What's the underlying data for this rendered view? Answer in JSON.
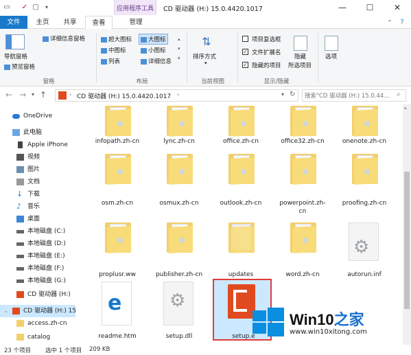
{
  "titlebar": {
    "context_tab": "应用程序工具",
    "title": "CD 驱动器 (H:) 15.0.4420.1017",
    "minimize": "—",
    "maximize": "☐",
    "close": "✕"
  },
  "tabs": {
    "file": "文件",
    "home": "主页",
    "share": "共享",
    "view": "查看",
    "manage": "管理"
  },
  "ribbon": {
    "nav_pane": "导航窗格",
    "preview_pane": "预览窗格",
    "details_pane": "详细信息窗格",
    "group_panes": "窗格",
    "layout": {
      "xl_icons": "超大图标",
      "large_icons": "大图标",
      "medium_icons": "中图标",
      "small_icons": "小图标",
      "list": "列表",
      "details": "详细信息"
    },
    "group_layout": "布局",
    "sort_by": "排序方式",
    "group_current_view": "当前视图",
    "item_checkboxes": "项目复选框",
    "file_ext": "文件扩展名",
    "hidden_items": "隐藏的项目",
    "hide_selected_1": "隐藏",
    "hide_selected_2": "所选项目",
    "group_show_hide": "显示/隐藏",
    "options": "选项",
    "checks": {
      "item_checkboxes": false,
      "file_ext": true,
      "hidden_items": true
    }
  },
  "address": {
    "path": "CD 驱动器 (H:) 15.0.4420.1017",
    "search_placeholder": "搜索\"CD 驱动器 (H:) 15.0.44..."
  },
  "sidebar": {
    "items": [
      "OneDrive",
      "此电脑",
      "Apple iPhone",
      "视频",
      "图片",
      "文档",
      "下载",
      "音乐",
      "桌面",
      "本地磁盘 (C:)",
      "本地磁盘 (D:)",
      "本地磁盘 (E:)",
      "本地磁盘 (F:)",
      "本地磁盘 (G:)",
      "CD 驱动器 (H:)",
      "CD 驱动器 (H:) 15",
      "access.zh-cn",
      "catalog"
    ]
  },
  "files": {
    "row0": [
      "infopath.zh-cn",
      "lync.zh-cn",
      "office.zh-cn",
      "office32.zh-cn",
      "onenote.zh-cn"
    ],
    "row1": [
      "osm.zh-cn",
      "osmux.zh-cn",
      "outlook.zh-cn",
      "powerpoint.zh-cn",
      "proofing.zh-cn"
    ],
    "row2": [
      "proplusr.ww",
      "publisher.zh-cn",
      "updates",
      "word.zh-cn",
      "autorun.inf"
    ],
    "row3": [
      "readme.htm",
      "setup.dll",
      "setup.e"
    ]
  },
  "status": {
    "count": "23 个项目",
    "selected": "选中 1 个项目",
    "size": "209 KB"
  },
  "watermark": {
    "brand_a": "Win10",
    "brand_b": "之家",
    "url": "www.win10xitong.com"
  },
  "colors": {
    "accent": "#1979ca",
    "folder": "#f3cf6b",
    "selection": "#e03a3a"
  }
}
